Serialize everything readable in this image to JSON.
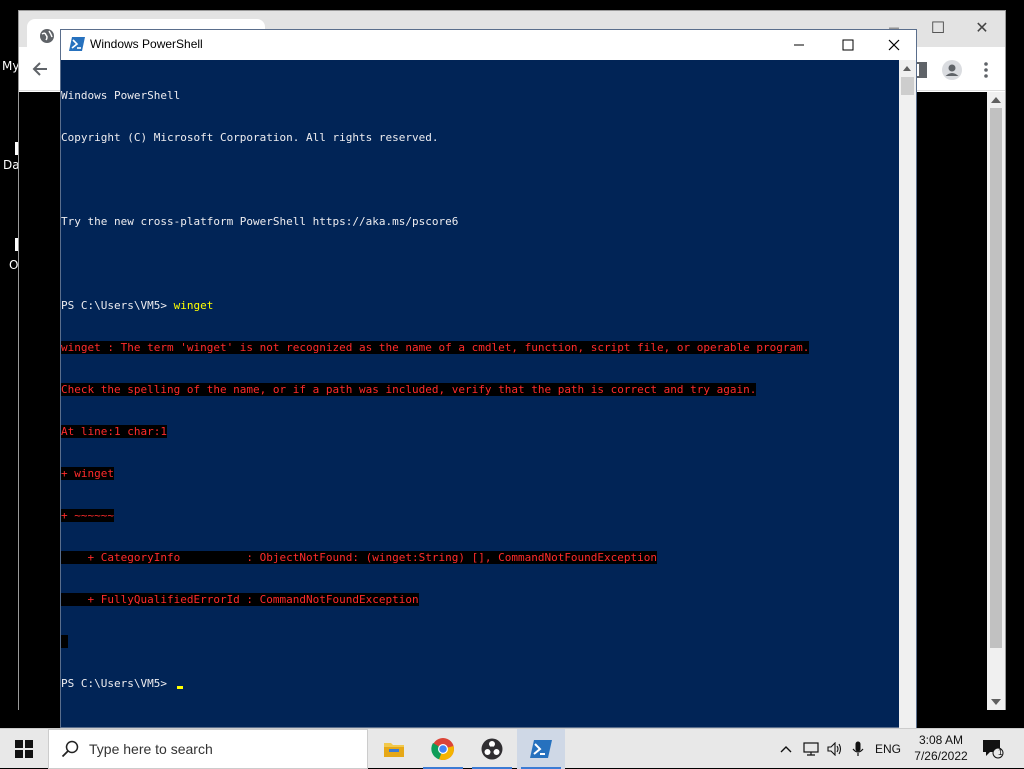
{
  "desktop": {
    "fragments": [
      "My",
      "Da",
      "O"
    ]
  },
  "chrome": {
    "minimize": "—",
    "maximize": "☐",
    "close": "✕",
    "dropdown": "⌄"
  },
  "powershell": {
    "title": "Windows PowerShell",
    "lines": [
      {
        "text": "Windows PowerShell",
        "type": "normal"
      },
      {
        "text": "Copyright (C) Microsoft Corporation. All rights reserved.",
        "type": "normal"
      },
      {
        "text": "",
        "type": "normal"
      },
      {
        "text": "Try the new cross-platform PowerShell https://aka.ms/pscore6",
        "type": "normal"
      },
      {
        "text": "",
        "type": "normal"
      }
    ],
    "prompt": "PS C:\\Users\\VM5> ",
    "command": "winget",
    "errors": [
      "winget : The term 'winget' is not recognized as the name of a cmdlet, function, script file, or operable program.",
      "Check the spelling of the name, or if a path was included, verify that the path is correct and try again.",
      "At line:1 char:1",
      "+ winget",
      "+ ~~~~~~",
      "    + CategoryInfo          : ObjectNotFound: (winget:String) [], CommandNotFoundException",
      "    + FullyQualifiedErrorId : CommandNotFoundException",
      " "
    ],
    "final_prompt": "PS C:\\Users\\VM5> "
  },
  "taskbar": {
    "search_placeholder": "Type here to search",
    "language": "ENG",
    "time": "3:08 AM",
    "date": "7/26/2022",
    "notification_count": "1",
    "colors": {
      "powershell_bg": "#012456",
      "error_text": "#ff2b2b",
      "command_text": "#ffff00"
    }
  }
}
